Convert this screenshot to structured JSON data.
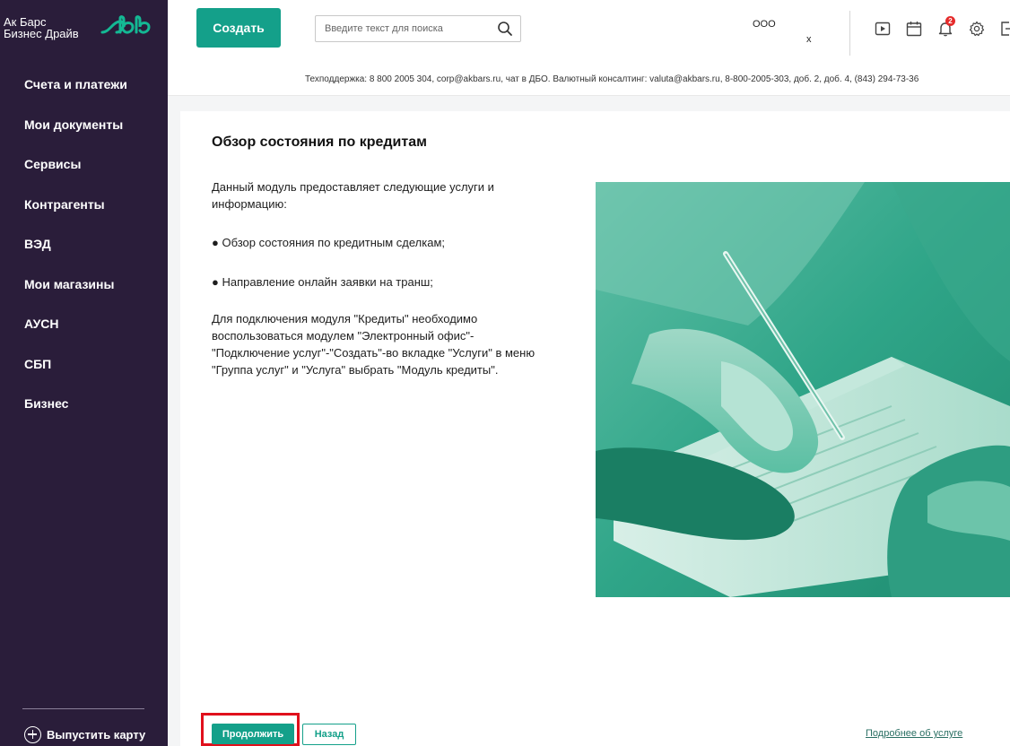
{
  "app": {
    "logo_line1": "Ак Барс",
    "logo_line2": "Бизнес Драйв",
    "brand_color": "#14a08a",
    "sidebar_color": "#2a1d3a"
  },
  "sidebar": {
    "items": [
      {
        "label": "Счета и платежи"
      },
      {
        "label": "Мои документы"
      },
      {
        "label": "Сервисы"
      },
      {
        "label": "Контрагенты"
      },
      {
        "label": "ВЭД"
      },
      {
        "label": "Мои магазины"
      },
      {
        "label": "АУСН"
      },
      {
        "label": "СБП"
      },
      {
        "label": "Бизнес"
      }
    ],
    "issue_card_label": "Выпустить карту"
  },
  "header": {
    "create_label": "Создать",
    "search_placeholder": "Введите текст для поиска",
    "org_name": "ООО",
    "org_suffix": "х",
    "notification_count": "2",
    "icons": [
      "play-icon",
      "calendar-icon",
      "bell-icon",
      "gear-icon",
      "logout-icon"
    ],
    "support_text": "Техподдержка: 8 800 2005 304, corp@akbars.ru, чат в ДБО. Валютный консалтинг: valuta@akbars.ru, 8-800-2005-303, доб. 2, доб. 4, (843) 294-73-36"
  },
  "main": {
    "title": "Обзор состояния по кредитам",
    "intro": "Данный модуль предоставляет следующие услуги и информацию:",
    "bullet1": "● Обзор состояния по кредитным сделкам;",
    "bullet2": "● Направление онлайн заявки на транш;",
    "instructions": "Для подключения модуля \"Кредиты\" необходимо воспользоваться модулем \"Электронный офис\"-\"Подключение услуг\"-\"Создать\"-во вкладке \"Услуги\" в меню \"Группа услуг\" и \"Услуга\" выбрать \"Модуль кредиты\".",
    "more_link": "Подробнее об услуге",
    "continue_label": "Продолжить",
    "back_label": "Назад"
  }
}
